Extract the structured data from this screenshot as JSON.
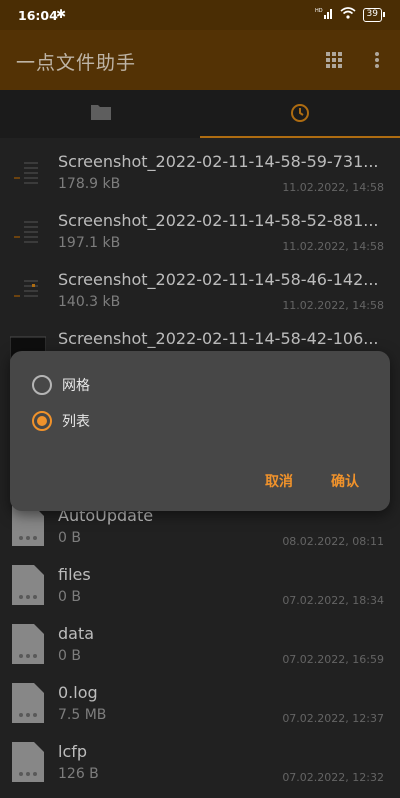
{
  "status_bar": {
    "time": "16:04",
    "bluetooth": "✱",
    "signal": "HD",
    "wifi": "wifi",
    "battery": "39"
  },
  "app_bar": {
    "title": "一点文件助手"
  },
  "tabs": [
    {
      "icon": "folder-icon"
    },
    {
      "icon": "clock-icon",
      "selected": true
    }
  ],
  "files": [
    {
      "name": "Screenshot_2022-02-11-14-58-59-731...",
      "size": "178.9 kB",
      "date": "11.02.2022, 14:58",
      "type": "image"
    },
    {
      "name": "Screenshot_2022-02-11-14-58-52-881...",
      "size": "197.1 kB",
      "date": "11.02.2022, 14:58",
      "type": "image"
    },
    {
      "name": "Screenshot_2022-02-11-14-58-46-142...",
      "size": "140.3 kB",
      "date": "11.02.2022, 14:58",
      "type": "image"
    },
    {
      "name": "Screenshot_2022-02-11-14-58-42-106...",
      "size": "",
      "date": "",
      "type": "image"
    },
    {
      "name": "",
      "size": "",
      "date": "",
      "type": "doc"
    },
    {
      "name": "",
      "size": "",
      "date": "",
      "type": "doc"
    },
    {
      "name": "AutoUpdate",
      "size": "0 B",
      "date": "08.02.2022, 08:11",
      "type": "doc"
    },
    {
      "name": "files",
      "size": "0 B",
      "date": "07.02.2022, 18:34",
      "type": "doc"
    },
    {
      "name": "data",
      "size": "0 B",
      "date": "07.02.2022, 16:59",
      "type": "doc"
    },
    {
      "name": "0.log",
      "size": "7.5 MB",
      "date": "07.02.2022, 12:37",
      "type": "doc"
    },
    {
      "name": "lcfp",
      "size": "126 B",
      "date": "07.02.2022, 12:32",
      "type": "doc"
    }
  ],
  "dialog": {
    "options": [
      {
        "label": "网格",
        "checked": false
      },
      {
        "label": "列表",
        "checked": true
      }
    ],
    "cancel": "取消",
    "confirm": "确认"
  },
  "colors": {
    "accent": "#f0922b",
    "app_bar": "#5f3a06",
    "status_bar": "#4a2d04"
  }
}
